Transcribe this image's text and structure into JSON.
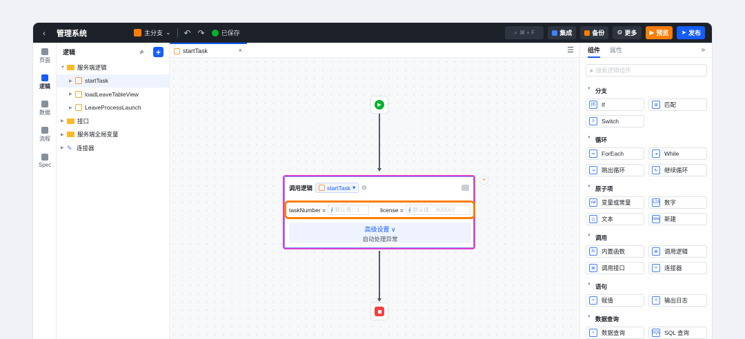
{
  "topbar": {
    "app_title": "管理系统",
    "branch_label": "主分支",
    "saved_label": "已保存",
    "search_shortcut": "⌘ + F",
    "integrate_label": "集成",
    "backup_label": "备份",
    "more_label": "更多",
    "preview_label": "预览",
    "publish_label": "发布"
  },
  "rail": {
    "items": [
      {
        "label": "页面"
      },
      {
        "label": "逻辑"
      },
      {
        "label": "数据"
      },
      {
        "label": "流程"
      },
      {
        "label": "Spec"
      }
    ]
  },
  "tree": {
    "title": "逻辑",
    "nodes": [
      {
        "label": "服务端逻辑"
      },
      {
        "label": "startTask"
      },
      {
        "label": "loadLeaveTableView"
      },
      {
        "label": "LeaveProcessLaunch"
      },
      {
        "label": "接口"
      },
      {
        "label": "服务端全局变量"
      },
      {
        "label": "连接器"
      }
    ]
  },
  "editor": {
    "tab_label": "startTask",
    "card": {
      "title": "调用逻辑",
      "logic_name": "startTask",
      "param1_name": "taskNumber =",
      "param1_placeholder": "默认值：1",
      "param2_name": "license =",
      "param2_placeholder": "默认值：'A00001'",
      "advanced_label": "高级设置 ∨",
      "exception_label": "自动处理异常"
    }
  },
  "rpanel": {
    "tab_components": "组件",
    "tab_properties": "属性",
    "search_placeholder": "搜索逻辑组件",
    "categories": [
      {
        "label": "分支",
        "items": [
          "If",
          "匹配",
          "Switch"
        ]
      },
      {
        "label": "循环",
        "items": [
          "ForEach",
          "While",
          "跳出循环",
          "继续循环"
        ]
      },
      {
        "label": "原子项",
        "items": [
          "变量或常量",
          "数字",
          "文本",
          "新建"
        ]
      },
      {
        "label": "调用",
        "items": [
          "内置函数",
          "调用逻辑",
          "调用接口",
          "连接器"
        ]
      },
      {
        "label": "语句",
        "items": [
          "赋值",
          "输出日志"
        ]
      },
      {
        "label": "数据查询",
        "items": [
          "数据查询",
          "SQL 查询"
        ]
      }
    ]
  },
  "colors": {
    "accent": "#165dff",
    "preview": "#ff7d00",
    "highlight": "#ff7d00",
    "card_border": "#e13fcc"
  }
}
